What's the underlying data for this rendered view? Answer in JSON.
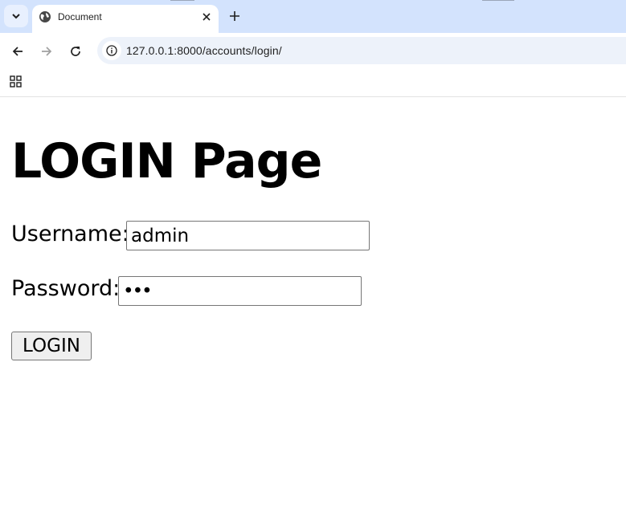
{
  "browser": {
    "tab": {
      "title": "Document"
    },
    "address_bar": {
      "url": "127.0.0.1:8000/accounts/login/"
    }
  },
  "page": {
    "heading": "LOGIN Page",
    "form": {
      "username_label": "Username:",
      "username_value": "admin",
      "password_label": "Password:",
      "password_value": "•••",
      "submit_label": "LOGIN"
    }
  },
  "icons": {
    "tab_search": "chevron-down-icon",
    "favicon": "globe-icon",
    "tab_close": "close-icon",
    "new_tab": "plus-icon",
    "back": "arrow-left-icon",
    "forward": "arrow-right-icon",
    "reload": "reload-icon",
    "site_info": "info-icon",
    "apps": "apps-grid-icon"
  },
  "colors": {
    "tabstrip": "#d3e3fd",
    "omnibox": "#edf2fa",
    "button_bg": "#efefef"
  }
}
